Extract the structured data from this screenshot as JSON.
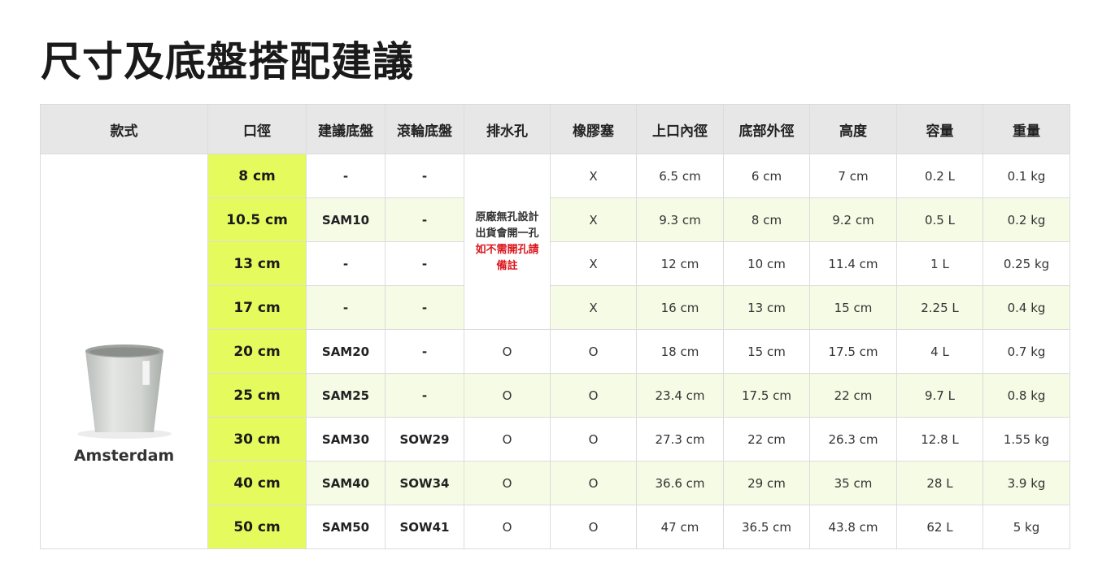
{
  "title": "尺寸及底盤搭配建議",
  "table": {
    "headers": [
      "款式",
      "口徑",
      "建議底盤",
      "滾輪底盤",
      "排水孔",
      "橡膠塞",
      "上口內徑",
      "底部外徑",
      "高度",
      "容量",
      "重量"
    ],
    "model": "Amsterdam",
    "drain_note": [
      "原廠無孔設計",
      "出貨會開一孔",
      "如不需開孔請",
      "備註"
    ],
    "rows": [
      {
        "size": "8 cm",
        "plate": "-",
        "wheel": "-",
        "stopper": "X",
        "top": "6.5 cm",
        "bottom": "6 cm",
        "height": "7 cm",
        "capacity": "0.2 L",
        "weight": "0.1 kg"
      },
      {
        "size": "10.5 cm",
        "plate": "SAM10",
        "wheel": "-",
        "stopper": "X",
        "top": "9.3 cm",
        "bottom": "8 cm",
        "height": "9.2 cm",
        "capacity": "0.5 L",
        "weight": "0.2 kg"
      },
      {
        "size": "13 cm",
        "plate": "-",
        "wheel": "-",
        "stopper": "X",
        "top": "12 cm",
        "bottom": "10 cm",
        "height": "11.4 cm",
        "capacity": "1 L",
        "weight": "0.25 kg"
      },
      {
        "size": "17 cm",
        "plate": "-",
        "wheel": "-",
        "stopper": "X",
        "top": "16 cm",
        "bottom": "13 cm",
        "height": "15 cm",
        "capacity": "2.25 L",
        "weight": "0.4 kg"
      },
      {
        "size": "20 cm",
        "plate": "SAM20",
        "wheel": "-",
        "drain": "O",
        "stopper": "O",
        "top": "18 cm",
        "bottom": "15 cm",
        "height": "17.5 cm",
        "capacity": "4 L",
        "weight": "0.7 kg"
      },
      {
        "size": "25 cm",
        "plate": "SAM25",
        "wheel": "-",
        "drain": "O",
        "stopper": "O",
        "top": "23.4 cm",
        "bottom": "17.5 cm",
        "height": "22 cm",
        "capacity": "9.7 L",
        "weight": "0.8 kg"
      },
      {
        "size": "30 cm",
        "plate": "SAM30",
        "wheel": "SOW29",
        "drain": "O",
        "stopper": "O",
        "top": "27.3 cm",
        "bottom": "22 cm",
        "height": "26.3 cm",
        "capacity": "12.8 L",
        "weight": "1.55 kg"
      },
      {
        "size": "40 cm",
        "plate": "SAM40",
        "wheel": "SOW34",
        "drain": "O",
        "stopper": "O",
        "top": "36.6 cm",
        "bottom": "29 cm",
        "height": "35 cm",
        "capacity": "28 L",
        "weight": "3.9 kg"
      },
      {
        "size": "50 cm",
        "plate": "SAM50",
        "wheel": "SOW41",
        "drain": "O",
        "stopper": "O",
        "top": "47 cm",
        "bottom": "36.5 cm",
        "height": "43.8 cm",
        "capacity": "62 L",
        "weight": "5 kg"
      }
    ]
  },
  "colors": {
    "size_highlight": "#e5fb5d",
    "alt_row": "#f6fbe5",
    "header_bg": "#e7e7e7",
    "note_red": "#d9141a"
  },
  "icons": {
    "product": "plant-pot-image"
  }
}
